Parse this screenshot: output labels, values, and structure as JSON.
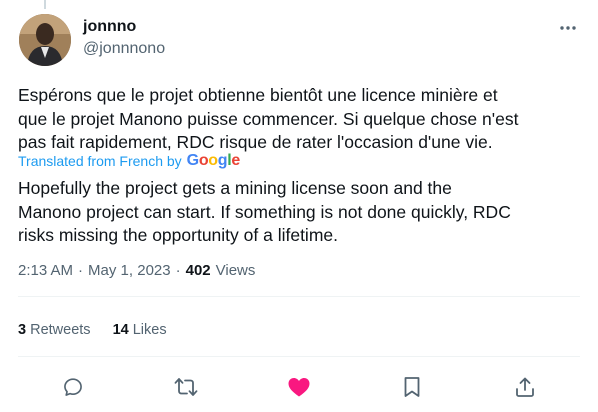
{
  "author": {
    "display_name": "jonnno",
    "handle": "@jonnnono"
  },
  "tweet": {
    "original_text": "Espérons que le projet obtienne bientôt une licence minière et\nque le projet Manono puisse commencer. Si quelque chose n'est\npas fait rapidement, RDC risque de rater l'occasion d'une vie.",
    "translated_label": "Translated from French by",
    "translator_brand": "Google",
    "translation_text": "Hopefully the project gets a mining license soon and the\nManono project can start. If something is not done quickly, RDC\nrisks missing the opportunity of a lifetime."
  },
  "meta": {
    "time": "2:13 AM",
    "separator": "·",
    "date": "May 1, 2023",
    "views_count": "402",
    "views_label": "Views"
  },
  "stats": {
    "retweets_count": "3",
    "retweets_label": "Retweets",
    "likes_count": "14",
    "likes_label": "Likes"
  },
  "actions": {
    "reply_icon": "reply-icon",
    "retweet_icon": "retweet-icon",
    "like_icon": "heart-filled-icon",
    "bookmark_icon": "bookmark-icon",
    "share_icon": "share-icon"
  },
  "colors": {
    "accent": "#1d9bf0",
    "like": "#f91880",
    "muted": "#536471",
    "text": "#0f1419"
  }
}
